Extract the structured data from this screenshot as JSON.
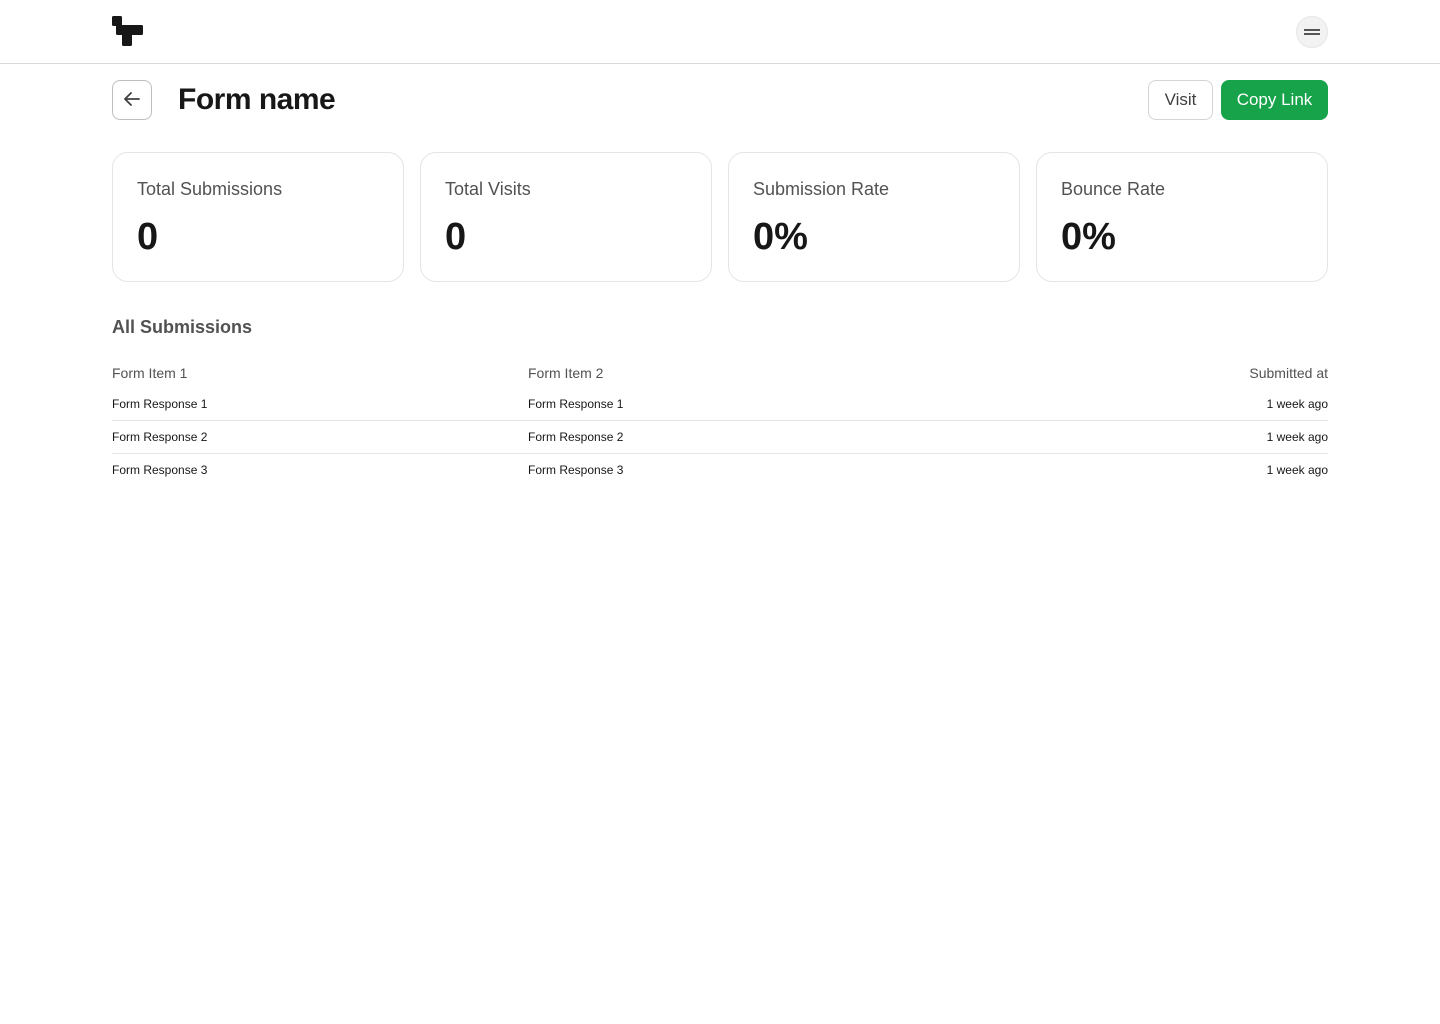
{
  "header": {
    "logo_icon": "brand-logo-icon",
    "menu_icon": "menu-icon"
  },
  "page": {
    "title": "Form name",
    "back_icon": "arrow-left-icon",
    "visit_label": "Visit",
    "copy_link_label": "Copy Link",
    "accent_color": "#16a34a"
  },
  "stats": [
    {
      "label": "Total Submissions",
      "value": "0"
    },
    {
      "label": "Total Visits",
      "value": "0"
    },
    {
      "label": "Submission Rate",
      "value": "0%"
    },
    {
      "label": "Bounce Rate",
      "value": "0%"
    }
  ],
  "submissions": {
    "title": "All Submissions",
    "columns": [
      "Form Item 1",
      "Form Item 2",
      "Submitted at"
    ],
    "rows": [
      [
        "Form Response 1",
        "Form Response 1",
        "1 week ago"
      ],
      [
        "Form Response 2",
        "Form Response 2",
        "1 week ago"
      ],
      [
        "Form Response 3",
        "Form Response 3",
        "1 week ago"
      ]
    ]
  }
}
